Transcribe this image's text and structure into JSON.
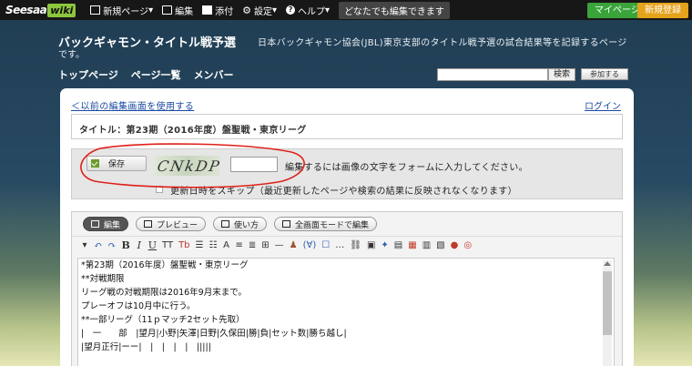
{
  "topbar": {
    "logo_text": "Seesaa",
    "logo_wiki": "wiki",
    "new_page": "新規ページ",
    "edit": "編集",
    "attach": "添付",
    "settings": "設定",
    "help": "ヘルプ",
    "anyone_edit": "どなたでも編集できます",
    "mypage": "マイページ",
    "register": "新規登録"
  },
  "header": {
    "title": "バックギャモン・タイトル戦予選",
    "description": "日本バックギャモン協会(JBL)東京支部のタイトル戦予選の試合結果等を記録するページ",
    "description_end": "です。",
    "nav": [
      "トップページ",
      "ページ一覧",
      "メンバー"
    ],
    "search_button": "検索",
    "join_button": "参加する"
  },
  "panel": {
    "old_editor_link": "＜以前の編集画面を使用する",
    "login_link": "ログイン",
    "page_title": "タイトル：第23期（2016年度）盤聖戦・東京リーグ"
  },
  "captcha": {
    "save_label": "保存",
    "image_text": "CNkDP",
    "instruction": "編集するには画像の文字をフォームに入力してください。",
    "skip_label": "更新日時をスキップ（最近更新したページや検索の結果に反映されなくなります）"
  },
  "editor": {
    "tabs": [
      "編集",
      "プレビュー",
      "使い方",
      "全画面モードで編集"
    ],
    "toolbar": [
      "▾",
      "↶",
      "↷",
      "B",
      "I",
      "U",
      "TT",
      "Tb",
      "☰",
      "☷",
      "A",
      "≡",
      "≣",
      "⊞",
      "—",
      "♟",
      "(∀)",
      "☐",
      "…",
      "⛓",
      "▣",
      "✦",
      "▤",
      "▦",
      "▥",
      "▧",
      "●",
      "◎"
    ],
    "lines": [
      "*第23期（2016年度）盤聖戦・東京リーグ",
      "**対戦期限",
      "リーグ戦の対戦期限は2016年9月末まで。",
      "プレーオフは10月中に行う。",
      "",
      "**一部リーグ（11ｐマッチ2セット先取）",
      "|　一　　部　|望月|小野|矢澤|日野|久保田|勝|負|セット数|勝ち越し|",
      "|望月正行|ーー|　|　|　|　|　|||||"
    ]
  },
  "colors": {
    "accent_green": "#3aa43a",
    "accent_orange": "#e5a21b",
    "link_blue": "#1a4aa0",
    "annotation_red": "#e0201a"
  }
}
